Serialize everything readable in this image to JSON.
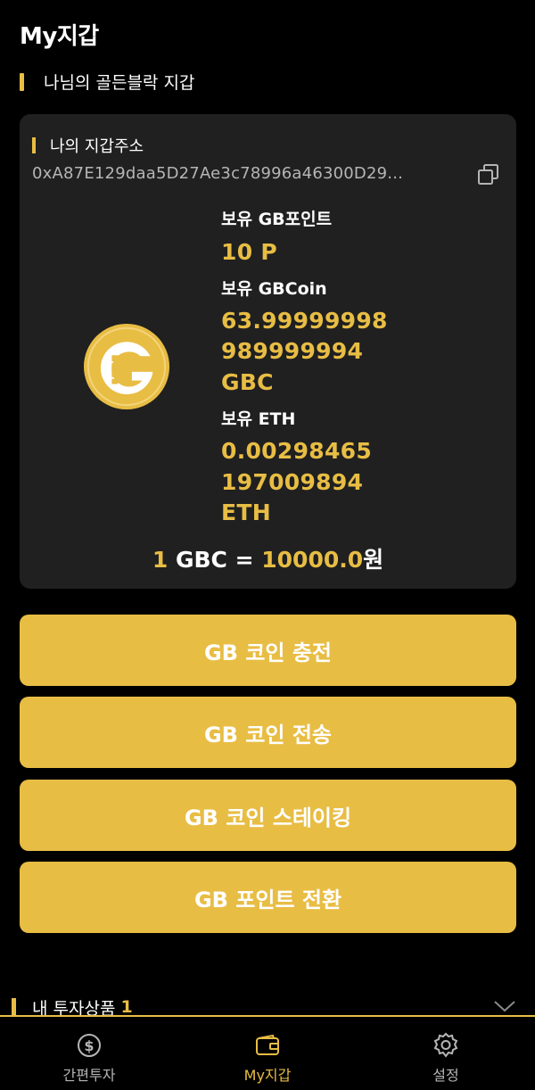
{
  "header": {
    "title": "My지갑"
  },
  "golden_block_section": {
    "title": "나님의 골든블락 지갑"
  },
  "wallet": {
    "address_label": "나의 지갑주소",
    "address": "0xA87E129daa5D27Ae3c78996a46300D29...",
    "gb_point_label": "보유 GB포인트",
    "gb_point_value": "10 P",
    "gbcoin_label": "보유 GBCoin",
    "gbcoin_value_line1": "63.99999998",
    "gbcoin_value_line2": "989999994",
    "gbcoin_unit": "GBC",
    "eth_label": "보유 ETH",
    "eth_value_line1": "0.00298465",
    "eth_value_line2": "197009894",
    "eth_unit": "ETH",
    "rate_prefix": "1",
    "rate_unit": "GBC =",
    "rate_value": "10000.0",
    "rate_currency": "원"
  },
  "actions": {
    "charge": "GB 코인 충전",
    "send": "GB 코인 전송",
    "staking": "GB 코인 스테이킹",
    "point_convert": "GB 포인트 전환"
  },
  "investments": {
    "label": "내 투자상품",
    "count": "1"
  },
  "bottom_nav": {
    "simple_invest": "간편투자",
    "my_wallet": "My지갑",
    "settings": "설정"
  },
  "colors": {
    "accent": "#e8bd44",
    "card": "#202020",
    "background": "#000000"
  }
}
